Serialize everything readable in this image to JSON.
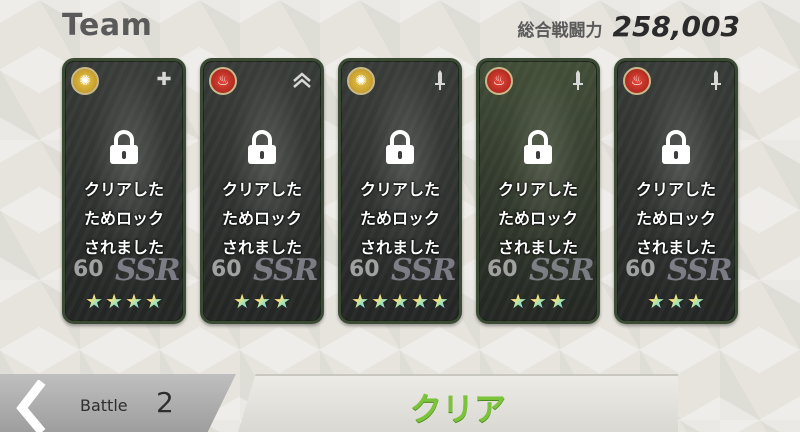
{
  "header": {
    "title": "Team",
    "power_label": "総合戦闘力",
    "power_value": "258,003"
  },
  "cards": [
    {
      "element": "sun-element-icon",
      "role": "healer-cross-icon",
      "lock_text": "クリアした\nためロック\nされました",
      "level": "60",
      "rarity": "SSR",
      "stars": 4
    },
    {
      "element": "fire-element-icon",
      "role": "chevron-up-icon",
      "lock_text": "クリアした\nためロック\nされました",
      "level": "60",
      "rarity": "SSR",
      "stars": 3
    },
    {
      "element": "sun-element-icon",
      "role": "sword-icon",
      "lock_text": "クリアした\nためロック\nされました",
      "level": "60",
      "rarity": "SSR",
      "stars": 5
    },
    {
      "element": "fire-element-icon",
      "role": "sword-icon",
      "lock_text": "クリアした\nためロック\nされました",
      "level": "60",
      "rarity": "SSR",
      "stars": 3
    },
    {
      "element": "fire-element-icon",
      "role": "sword-icon",
      "lock_text": "クリアした\nためロック\nされました",
      "level": "60",
      "rarity": "SSR",
      "stars": 3
    }
  ],
  "bottom": {
    "battle_label": "Battle",
    "battle_value": "2",
    "status": "クリア"
  },
  "colors": {
    "clear_green": "#7bc33a",
    "fire_element": "#d3362a",
    "sun_element": "#d8b43a"
  }
}
